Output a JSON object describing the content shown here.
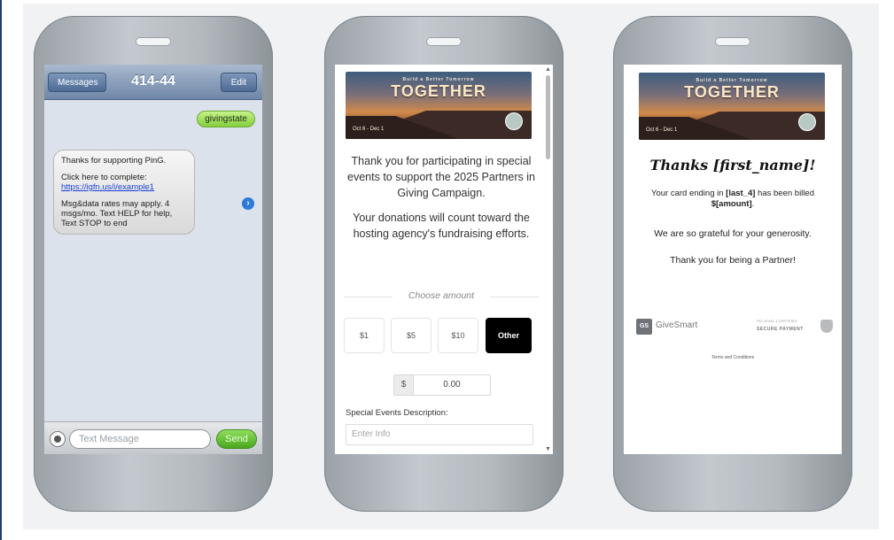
{
  "phone1": {
    "header": {
      "back_label": "Messages",
      "title": "414-44",
      "edit_label": "Edit"
    },
    "sent_message": "givingstate",
    "received_message": {
      "line1": "Thanks for supporting PinG.",
      "line2": "Click here to complete:",
      "link": "https://igfn.us/i/example1",
      "line3": "Msg&data rates may apply. 4 msgs/mo. Text HELP for help, Text STOP to end"
    },
    "footer": {
      "input_placeholder": "Text Message",
      "send_label": "Send"
    }
  },
  "phone2": {
    "banner": {
      "tagline": "Build a Better Tomorrow",
      "headline": "TOGETHER",
      "dates": "Oct 6 - Dec 1"
    },
    "thank_you_text": "Thank you for participating in special events to support the 2025 Partners in Giving Campaign.",
    "donations_text": "Your donations will count toward the hosting agency's fundraising efforts.",
    "choose_amount_label": "Choose amount",
    "amount_options": [
      "$1",
      "$5",
      "$10",
      "Other"
    ],
    "selected_amount": "Other",
    "currency_symbol": "$",
    "amount_value": "0.00",
    "description_label": "Special Events Description:",
    "description_placeholder": "Enter Info"
  },
  "phone3": {
    "banner": {
      "tagline": "Build a Better Tomorrow",
      "headline": "TOGETHER",
      "dates": "Oct 6 - Dec 1"
    },
    "thanks_heading": "Thanks [first_name]!",
    "card_text_prefix": "Your card ending in ",
    "card_token": "[last_4]",
    "card_text_mid": " has been billed ",
    "amount_token": "$[amount]",
    "grateful_text": "We are so grateful for your generosity.",
    "partner_text": "Thank you for being a Partner!",
    "givesmart": {
      "mark": "GS",
      "name": "GiveSmart"
    },
    "secure_badge": {
      "small": "PCI LEVEL 1 CERTIFIED",
      "big": "SECURE PAYMENT"
    },
    "terms_label": "Terms and Conditions"
  },
  "colors": {
    "send_green": "#4aa61e",
    "bubble_green": "#83cf3f",
    "header_blue": "#6f87a8",
    "link_blue": "#1a3fd6"
  }
}
